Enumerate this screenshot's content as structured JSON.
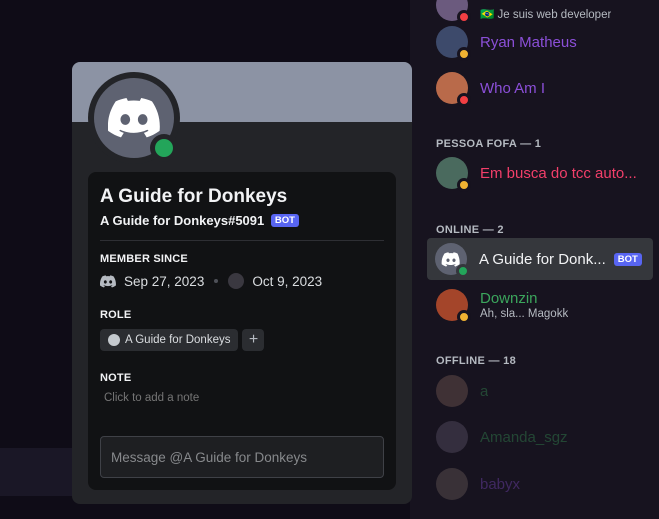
{
  "colors": {
    "online": "#23a55a",
    "dnd": "#f23f43",
    "idle": "#f0b232",
    "bot_badge": "#5865f2",
    "role_purple": "#8b4fd8",
    "pessoa_red": "#f23f6a",
    "green_name": "#3ba55c"
  },
  "member_list": {
    "top_member": {
      "status": "🇧🇷 Je suis web developer"
    },
    "members_a": [
      {
        "name": "Ryan Matheus"
      },
      {
        "name": "Who Am I"
      }
    ],
    "group_pessoa": "PESSOA FOFA — 1",
    "pessoa_member": {
      "name": "Em busca do tcc auto..."
    },
    "group_online": "ONLINE — 2",
    "bot_member": {
      "name": "A Guide for Donk...",
      "badge": "BOT"
    },
    "downzin": {
      "name": "Downzin",
      "status": "Ah, sla... Magokk"
    },
    "group_offline": "OFFLINE — 18",
    "offline_members": [
      {
        "name": "a"
      },
      {
        "name": "Amanda_sgz"
      },
      {
        "name": "babyx"
      }
    ]
  },
  "profile": {
    "display_name": "A Guide for Donkeys",
    "username": "A Guide for Donkeys#5091",
    "badge": "BOT",
    "member_since_title": "MEMBER SINCE",
    "discord_date": "Sep 27, 2023",
    "server_date": "Oct 9, 2023",
    "role_title": "ROLE",
    "role_name": "A Guide for Donkeys",
    "add_role": "+",
    "note_title": "NOTE",
    "note_placeholder": "Click to add a note",
    "message_placeholder": "Message @A Guide for Donkeys"
  }
}
